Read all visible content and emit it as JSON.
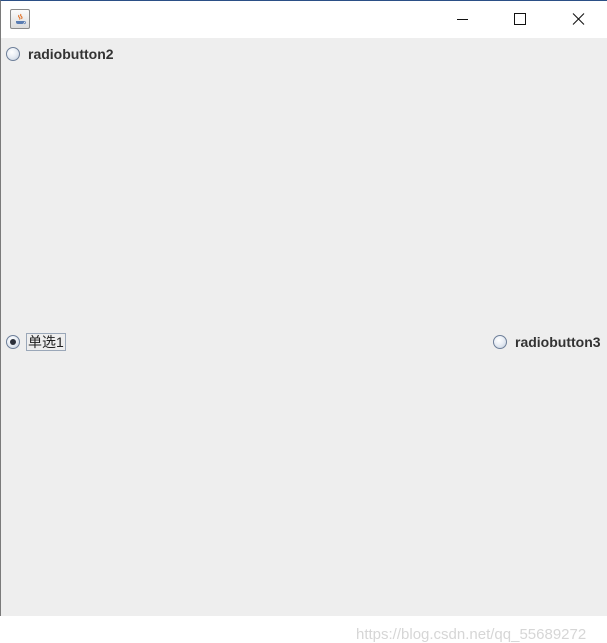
{
  "window": {
    "title": "",
    "icon": "java-app-icon",
    "controls": [
      "minimize-icon",
      "maximize-icon",
      "close-icon"
    ]
  },
  "radios": {
    "rb2": {
      "label": "radiobutton2",
      "checked": false
    },
    "rb1": {
      "label": "单选1",
      "checked": true
    },
    "rb3": {
      "label": "radiobutton3",
      "checked": false
    }
  },
  "watermark": "https://blog.csdn.net/qq_55689272"
}
